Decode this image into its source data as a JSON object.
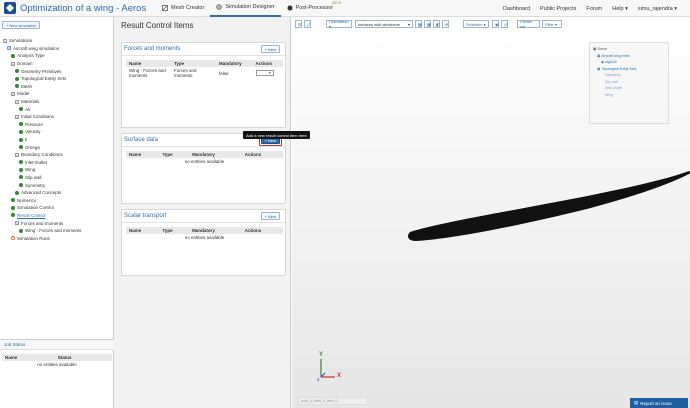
{
  "app": {
    "title": "Optimization of a wing - Aerospac..."
  },
  "topnav": [
    {
      "label": "Mesh Creator",
      "icon": "mesh-icon"
    },
    {
      "label": "Simulation Designer",
      "icon": "gear-icon",
      "active": true
    },
    {
      "label": "Post-Processor",
      "icon": "circle-icon",
      "badge": "BETA"
    }
  ],
  "rightnav": {
    "dashboard": "Dashboard",
    "public_projects": "Public Projects",
    "forum": "Forum",
    "help": "Help ▾",
    "user": "simu_rajendra ▾"
  },
  "left": {
    "new_simulation": "New simulation",
    "tree": [
      {
        "label": "Simulations",
        "indent": 0,
        "icon": "box"
      },
      {
        "label": "Aircraft wing simulation",
        "indent": 1,
        "icon": "folder"
      },
      {
        "label": "Analysis Type",
        "indent": 2,
        "icon": "check"
      },
      {
        "label": "Domain",
        "indent": 2,
        "icon": "box"
      },
      {
        "label": "Geometry Primitives",
        "indent": 3,
        "icon": "check"
      },
      {
        "label": "Topological Entity Sets",
        "indent": 3,
        "icon": "check"
      },
      {
        "label": "Mesh",
        "indent": 3,
        "icon": "check"
      },
      {
        "label": "Model",
        "indent": 2,
        "icon": "box"
      },
      {
        "label": "Materials",
        "indent": 3,
        "icon": "box"
      },
      {
        "label": "Air",
        "indent": 4,
        "icon": "check"
      },
      {
        "label": "Initial Conditions",
        "indent": 3,
        "icon": "box"
      },
      {
        "label": "Pressure",
        "indent": 4,
        "icon": "check"
      },
      {
        "label": "Velocity",
        "indent": 4,
        "icon": "check"
      },
      {
        "label": "k",
        "indent": 4,
        "icon": "check"
      },
      {
        "label": "Omega",
        "indent": 4,
        "icon": "check"
      },
      {
        "label": "Boundary Conditions",
        "indent": 3,
        "icon": "box"
      },
      {
        "label": "Inlet-Outlet",
        "indent": 4,
        "icon": "check"
      },
      {
        "label": "Wing",
        "indent": 4,
        "icon": "check"
      },
      {
        "label": "Slip wall",
        "indent": 4,
        "icon": "check"
      },
      {
        "label": "Symmetry",
        "indent": 4,
        "icon": "check"
      },
      {
        "label": "Advanced Concepts",
        "indent": 3,
        "icon": "check"
      },
      {
        "label": "Numerics",
        "indent": 2,
        "icon": "check"
      },
      {
        "label": "Simulation Control",
        "indent": 2,
        "icon": "check"
      },
      {
        "label": "Result Control",
        "indent": 2,
        "icon": "check",
        "link": true
      },
      {
        "label": "Forces and moments",
        "indent": 3,
        "icon": "box"
      },
      {
        "label": "Wing - Forces and moments",
        "indent": 4,
        "icon": "check"
      },
      {
        "label": "Simulation Runs",
        "indent": 2,
        "icon": "warn"
      }
    ],
    "job_status": {
      "title": "Job Status",
      "columns": [
        "Name",
        "Status"
      ],
      "empty": "no entities available"
    }
  },
  "middle": {
    "title": "Result Control Items",
    "columns": [
      "Name",
      "Type",
      "Mandatory",
      "Actions"
    ],
    "new_label": "New",
    "sections": [
      {
        "title": "Forces and moments",
        "rows": [
          {
            "name": "Wing - Forces and moments",
            "type": "Forces and moments",
            "mandatory": "false"
          }
        ],
        "empty": ""
      },
      {
        "title": "Surface data",
        "rows": [],
        "empty": "no entities available"
      },
      {
        "title": "Scalar transport",
        "rows": [],
        "empty": "no entities available"
      }
    ],
    "tooltip": "Add a new result control item here"
  },
  "viewer": {
    "toolbar": {
      "orientation": "Orientation ▾",
      "render_mode": "surfaces with wireframe",
      "selection": "Selection ▾",
      "create_set": "Create set",
      "filter": "Filter ▾"
    },
    "scene": {
      "items": [
        "Scene",
        "Aircraft wing mesh",
        "region0",
        "Topological Entity Sets",
        "Symmetry",
        "Slip wall",
        "Inlet-Outlet",
        "Wing"
      ]
    },
    "axes": {
      "x": "X",
      "y": "Y",
      "z": "Z"
    },
    "status_field": "solid_0_shell_0_face_0",
    "report": "Report an issue"
  },
  "colors": {
    "accent": "#2a6fb0",
    "highlight": "#d12b2b",
    "success": "#2e8b2e",
    "warning": "#e07a1f"
  }
}
